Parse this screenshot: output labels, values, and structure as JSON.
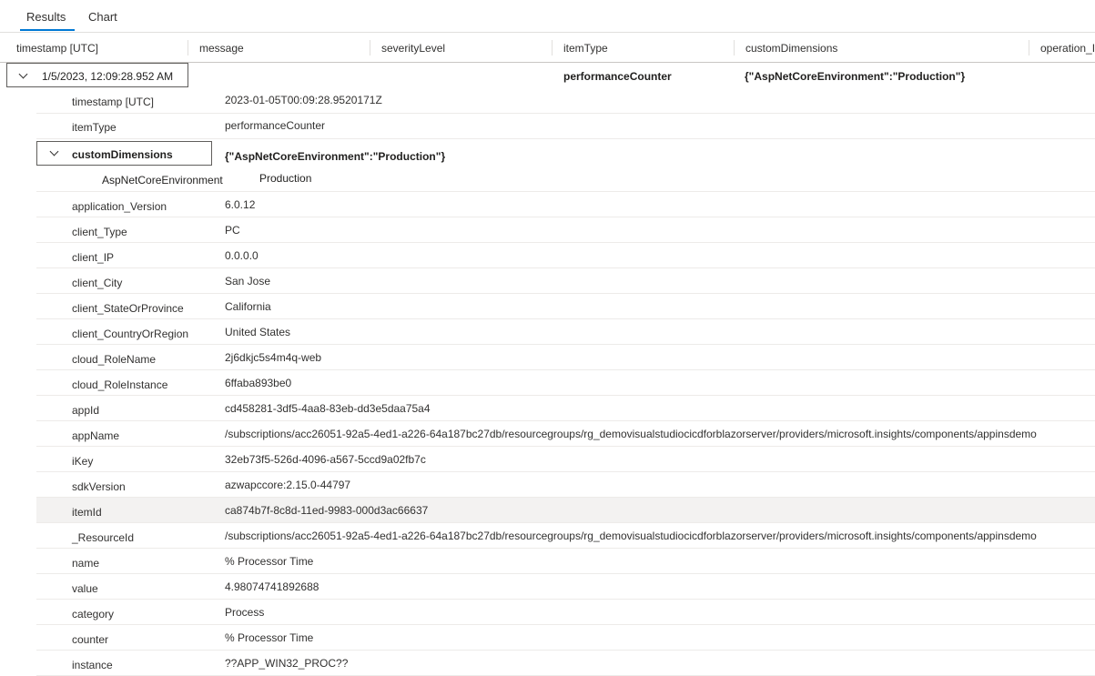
{
  "tabs": [
    {
      "label": "Results",
      "active": true
    },
    {
      "label": "Chart",
      "active": false
    }
  ],
  "columns": [
    "timestamp [UTC]",
    "message",
    "severityLevel",
    "itemType",
    "customDimensions",
    "operation_I"
  ],
  "row": {
    "timestamp": "1/5/2023, 12:09:28.952 AM",
    "itemType": "performanceCounter",
    "customDimensions": "{\"AspNetCoreEnvironment\":\"Production\"}"
  },
  "details": {
    "timestamp": {
      "key": "timestamp [UTC]",
      "value": "2023-01-05T00:09:28.9520171Z"
    },
    "itemType": {
      "key": "itemType",
      "value": "performanceCounter"
    },
    "customDimensions": {
      "key": "customDimensions",
      "value": "{\"AspNetCoreEnvironment\":\"Production\"}",
      "sub_key": "AspNetCoreEnvironment",
      "sub_value": "Production"
    },
    "fields": [
      {
        "key": "application_Version",
        "value": "6.0.12"
      },
      {
        "key": "client_Type",
        "value": "PC"
      },
      {
        "key": "client_IP",
        "value": "0.0.0.0"
      },
      {
        "key": "client_City",
        "value": "San Jose"
      },
      {
        "key": "client_StateOrProvince",
        "value": "California"
      },
      {
        "key": "client_CountryOrRegion",
        "value": "United States"
      },
      {
        "key": "cloud_RoleName",
        "value": "2j6dkjc5s4m4q-web"
      },
      {
        "key": "cloud_RoleInstance",
        "value": "6ffaba893be0"
      },
      {
        "key": "appId",
        "value": "cd458281-3df5-4aa8-83eb-dd3e5daa75a4"
      },
      {
        "key": "appName",
        "value": "/subscriptions/acc26051-92a5-4ed1-a226-64a187bc27db/resourcegroups/rg_demovisualstudiocicdforblazorserver/providers/microsoft.insights/components/appinsdemo"
      },
      {
        "key": "iKey",
        "value": "32eb73f5-526d-4096-a567-5ccd9a02fb7c"
      },
      {
        "key": "sdkVersion",
        "value": "azwapccore:2.15.0-44797"
      },
      {
        "key": "itemId",
        "value": "ca874b7f-8c8d-11ed-9983-000d3ac66637"
      },
      {
        "key": "_ResourceId",
        "value": "/subscriptions/acc26051-92a5-4ed1-a226-64a187bc27db/resourcegroups/rg_demovisualstudiocicdforblazorserver/providers/microsoft.insights/components/appinsdemo"
      },
      {
        "key": "name",
        "value": "% Processor Time"
      },
      {
        "key": "value",
        "value": "4.98074741892688"
      },
      {
        "key": "category",
        "value": "Process"
      },
      {
        "key": "counter",
        "value": "% Processor Time"
      },
      {
        "key": "instance",
        "value": "??APP_WIN32_PROC??"
      }
    ]
  }
}
